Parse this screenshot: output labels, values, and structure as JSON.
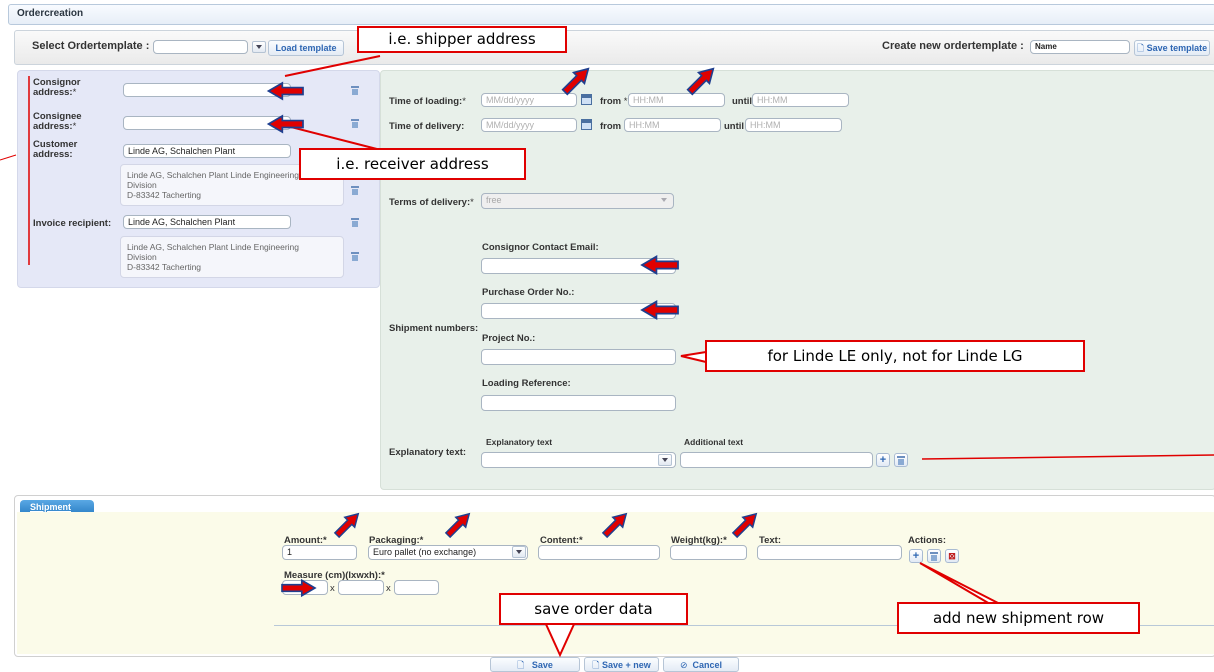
{
  "window": {
    "title": "Ordercreation"
  },
  "template_bar": {
    "select_label": "Select Ordertemplate :",
    "select_value": "",
    "load_button": "Load template",
    "create_label": "Create new ordertemplate :",
    "name_value": "Name",
    "save_button": "Save template"
  },
  "addresses": {
    "consignor_label": "Consignor address:",
    "consignee_label": "Consignee address:",
    "customer_label": "Customer address:",
    "customer_value": "Linde AG,  Schalchen Plant",
    "customer_detail": [
      "Linde AG, Schalchen Plant Linde Engineering",
      "Division",
      "D-83342 Tacherting"
    ],
    "invoice_label": "Invoice recipient:",
    "invoice_value": "Linde AG,  Schalchen Plant",
    "invoice_detail": [
      "Linde AG, Schalchen Plant Linde Engineering",
      "Division",
      "D-83342 Tacherting"
    ],
    "required_mark": "*"
  },
  "times": {
    "loading_label": "Time of loading:",
    "delivery_label": "Time of delivery:",
    "date_placeholder": "MM/dd/yyyy",
    "time_placeholder": "HH:MM",
    "from_label": "from",
    "until_label": "until"
  },
  "terms": {
    "label": "Terms of delivery:",
    "value": "free"
  },
  "shipment_numbers": {
    "section_label": "Shipment numbers:",
    "email_label": "Consignor Contact Email:",
    "po_label": "Purchase Order No.:",
    "project_label": "Project No.:",
    "loading_ref_label": "Loading Reference:"
  },
  "explanatory": {
    "section_label": "Explanatory text:",
    "col1": "Explanatory text",
    "col2": "Additional text"
  },
  "shipment_rows": {
    "tab_label": "Shipment rows",
    "amount_label": "Amount:*",
    "amount_value": "1",
    "packaging_label": "Packaging:*",
    "packaging_value": "Euro pallet (no exchange)",
    "content_label": "Content:*",
    "weight_label": "Weight(kg):*",
    "text_label": "Text:",
    "actions_label": "Actions:",
    "measure_label": "Measure (cm)(lxwxh):*",
    "times_sign": "x"
  },
  "footer": {
    "save": "Save",
    "save_new": "Save + new",
    "cancel": "Cancel"
  },
  "annotations": {
    "shipper": "i.e. shipper address",
    "receiver": "i.e. receiver address",
    "linde": "for Linde LE only, not for Linde LG",
    "save_order": "save order data",
    "add_row": "add new shipment row"
  },
  "colors": {
    "annotation_red": "#e00000",
    "arrow_blue": "#1f3f8f",
    "link_blue": "#2f67b3"
  },
  "icons": [
    "calendar-icon",
    "trash-icon",
    "plus-icon",
    "delete-row-icon",
    "chevron-down-icon",
    "document-icon",
    "cancel-icon",
    "arrow-icon"
  ]
}
